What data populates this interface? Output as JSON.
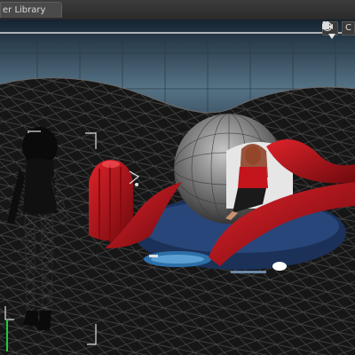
{
  "tabs": {
    "active_label": "er Library"
  },
  "viewport": {
    "camera_label": "C",
    "icons": [
      "navigation-icon",
      "camera-icon",
      "dropdown-arrow-icon"
    ]
  },
  "colors": {
    "sky_dark": "#1b2a36",
    "sky_light": "#5e7e93",
    "ground": "#151515",
    "wire": "#5a5a5a",
    "ship_red": "#b0141a",
    "ship_blue": "#1f3a66",
    "selection_white": "#e0e0e0",
    "axis_green": "#22cc33"
  }
}
